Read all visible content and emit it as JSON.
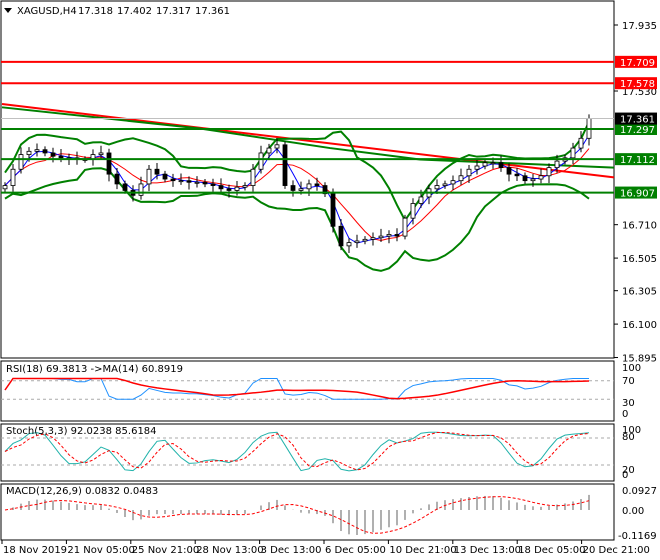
{
  "header": {
    "symbol": "XAGUSD,H4",
    "open": "17.318",
    "high": "17.402",
    "low": "17.317",
    "close": "17.361"
  },
  "colors": {
    "support": "#008000",
    "resistance": "#ff0000",
    "current": "#000000",
    "band": "#008000",
    "ma_fast": "#0000ff",
    "ma_slow": "#ff0000",
    "rsi": "#1e90ff",
    "stoch": "#20b2aa"
  },
  "chart_data": {
    "type": "candlestick",
    "title": "XAGUSD,H4",
    "price_ticks": [
      "17.935",
      "17.530",
      "16.710",
      "16.505",
      "16.305",
      "16.100",
      "15.895"
    ],
    "price_tick_values": [
      17.935,
      17.53,
      16.71,
      16.505,
      16.305,
      16.1,
      15.895
    ],
    "ylim": [
      15.87,
      18.07
    ],
    "x_labels": [
      "18 Nov 2019",
      "21 Nov 05:00",
      "25 Nov 21:00",
      "28 Nov 13:00",
      "3 Dec 13:00",
      "6 Dec 05:00",
      "10 Dec 21:00",
      "13 Dec 13:00",
      "18 Dec 05:00",
      "20 Dec 21:00"
    ],
    "closes": [
      16.95,
      17.05,
      17.14,
      17.16,
      17.17,
      17.15,
      17.13,
      17.12,
      17.12,
      17.11,
      17.11,
      17.14,
      17.15,
      17.02,
      16.96,
      16.92,
      16.89,
      16.96,
      17.05,
      17.02,
      16.99,
      16.98,
      16.98,
      16.97,
      16.97,
      16.96,
      16.95,
      16.93,
      16.92,
      16.94,
      16.95,
      17.05,
      17.15,
      17.18,
      17.2,
      16.95,
      16.92,
      16.93,
      16.96,
      16.95,
      16.9,
      16.7,
      16.58,
      16.6,
      16.61,
      16.62,
      16.63,
      16.64,
      16.65,
      16.64,
      16.75,
      16.84,
      16.88,
      16.93,
      16.95,
      16.96,
      16.98,
      17.01,
      17.05,
      17.07,
      17.09,
      17.09,
      17.06,
      17.02,
      17.01,
      16.98,
      16.99,
      17.01,
      17.06,
      17.1,
      17.12,
      17.18,
      17.24,
      17.361
    ],
    "levels": [
      {
        "label": "17.709",
        "value": 17.709,
        "kind": "resistance"
      },
      {
        "label": "17.578",
        "value": 17.578,
        "kind": "resistance"
      },
      {
        "label": "17.297",
        "value": 17.297,
        "kind": "support"
      },
      {
        "label": "17.112",
        "value": 17.112,
        "kind": "support"
      },
      {
        "label": "16.907",
        "value": 16.907,
        "kind": "support"
      }
    ],
    "current_price": {
      "label": "17.361",
      "value": 17.361
    },
    "trendlines": [
      {
        "name": "red-trendline",
        "from": 17.45,
        "to": 17.0
      },
      {
        "name": "green-trendline",
        "from": 17.43,
        "to": 17.06
      }
    ]
  },
  "rsi": {
    "label": "RSI(18) 69.3813  ->MA(14) 60.8919",
    "ticks": [
      "100",
      "70",
      "30",
      "0"
    ]
  },
  "stoch": {
    "label": "Stoch(5,3,3) 92.0238 85.6184",
    "ticks": [
      "100",
      "80",
      "20",
      "0"
    ]
  },
  "macd": {
    "label": "MACD(12,26,9) 0.0832 0.0483",
    "ticks": [
      "0.0927",
      "0.00",
      "-0.1169"
    ],
    "max": 0.0927,
    "min": -0.1169
  }
}
